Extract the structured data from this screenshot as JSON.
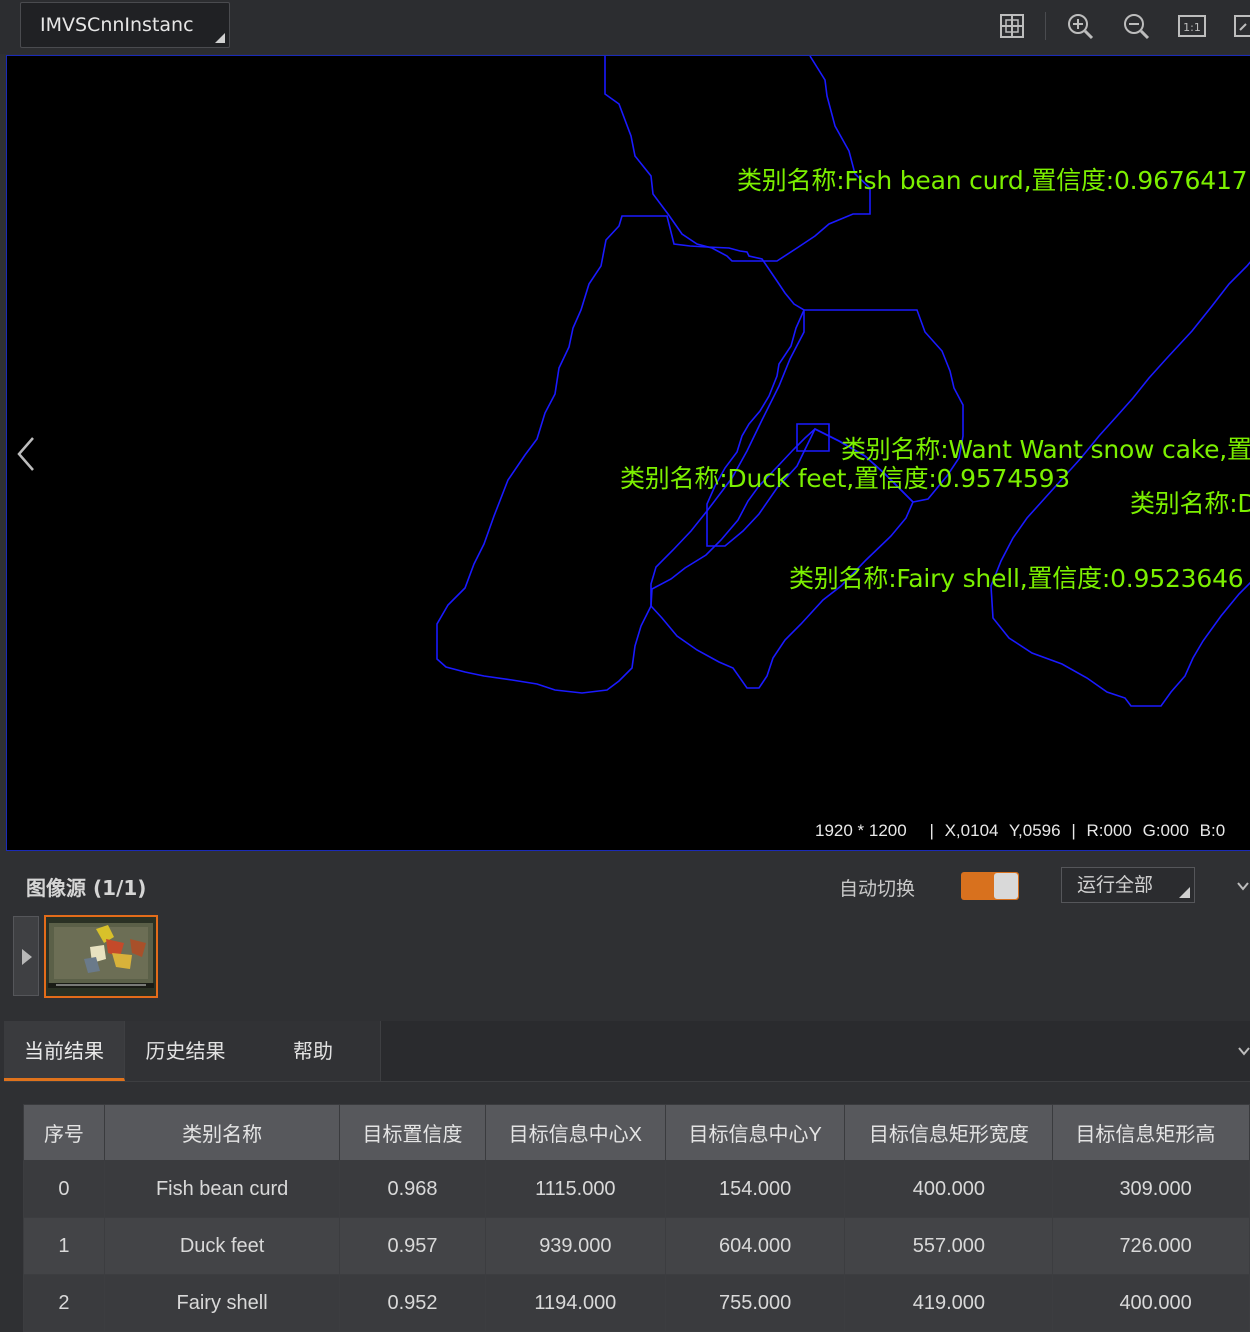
{
  "toolbar": {
    "instance_name": "IMVSCnnInstanc",
    "icons": [
      "fit-window-icon",
      "zoom-in-icon",
      "zoom-out-icon",
      "actual-size-icon",
      "fullscreen-icon"
    ]
  },
  "viewer": {
    "detections": [
      {
        "label": "类别名称:Fish bean curd,置信度:0.9676417"
      },
      {
        "label": "类别名称:Want Want snow cake,置"
      },
      {
        "label": "类别名称:Duck feet,置信度:0.9574593"
      },
      {
        "label": "类别名称:D"
      },
      {
        "label": "类别名称:Fairy shell,置信度:0.9523646"
      }
    ],
    "status": {
      "resolution": "1920 * 1200",
      "sep1": "|",
      "x": "X,0104",
      "y": "Y,0596",
      "sep2": "|",
      "r": "R:000",
      "g": "G:000",
      "b": "B:0"
    },
    "colors": {
      "outline": "#1a1aff",
      "label": "#7cf000"
    }
  },
  "source": {
    "title": "图像源 (1/1)",
    "auto_switch_label": "自动切换",
    "auto_switch_on": true,
    "run_all_label": "运行全部"
  },
  "tabs": [
    {
      "label": "当前结果",
      "active": true
    },
    {
      "label": "历史结果",
      "active": false
    },
    {
      "label": "帮助",
      "active": false
    }
  ],
  "table": {
    "headers": [
      "序号",
      "类别名称",
      "目标置信度",
      "目标信息中心X",
      "目标信息中心Y",
      "目标信息矩形宽度",
      "目标信息矩形高"
    ],
    "rows": [
      [
        "0",
        "Fish bean curd",
        "0.968",
        "1115.000",
        "154.000",
        "400.000",
        "309.000"
      ],
      [
        "1",
        "Duck feet",
        "0.957",
        "939.000",
        "604.000",
        "557.000",
        "726.000"
      ],
      [
        "2",
        "Fairy shell",
        "0.952",
        "1194.000",
        "755.000",
        "419.000",
        "400.000"
      ]
    ]
  },
  "accent_color": "#e0731c"
}
